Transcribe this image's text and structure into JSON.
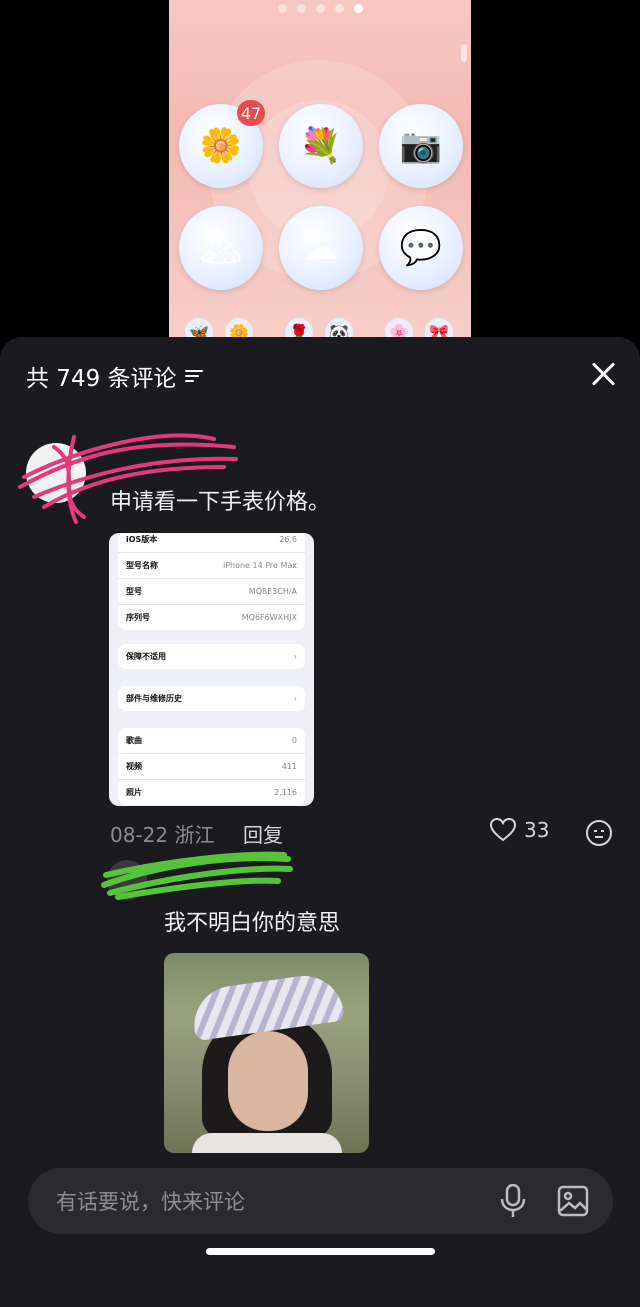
{
  "video": {
    "badge_count": "47",
    "apps": [
      {
        "icon": "butterfly-flower-icon",
        "glyph": "🌼"
      },
      {
        "icon": "person-flower-icon",
        "glyph": "💐"
      },
      {
        "icon": "camera-flower-icon",
        "glyph": "📷"
      },
      {
        "icon": "mountain-flower-icon",
        "glyph": "🏔"
      },
      {
        "icon": "cloud-flower-icon",
        "glyph": "☁"
      },
      {
        "icon": "chat-flower-icon",
        "glyph": "💬"
      }
    ]
  },
  "sheet": {
    "header": {
      "total_comments": "共 749 条评论"
    }
  },
  "comments": [
    {
      "text": "申请看一下手表价格。",
      "attachment_rows": {
        "card1": [
          {
            "label": "iOS版本",
            "value": "26.6"
          },
          {
            "label": "型号名称",
            "value": "iPhone 14 Pro Max"
          },
          {
            "label": "型号",
            "value": "MQ8E3CH/A"
          },
          {
            "label": "序列号",
            "value": "MQ6F6WXHJX"
          }
        ],
        "card2": [
          {
            "label": "保障不适用",
            "value": ""
          }
        ],
        "card3": [
          {
            "label": "部件与维修历史",
            "value": ""
          }
        ],
        "card4": [
          {
            "label": "歌曲",
            "value": "0"
          },
          {
            "label": "视频",
            "value": "411"
          },
          {
            "label": "照片",
            "value": "2,116"
          }
        ]
      },
      "date_location": "08-22 浙江",
      "reply_label": "回复",
      "likes": "33"
    },
    {
      "text": "我不明白你的意思"
    }
  ],
  "input": {
    "placeholder": "有话要说，快来评论"
  }
}
